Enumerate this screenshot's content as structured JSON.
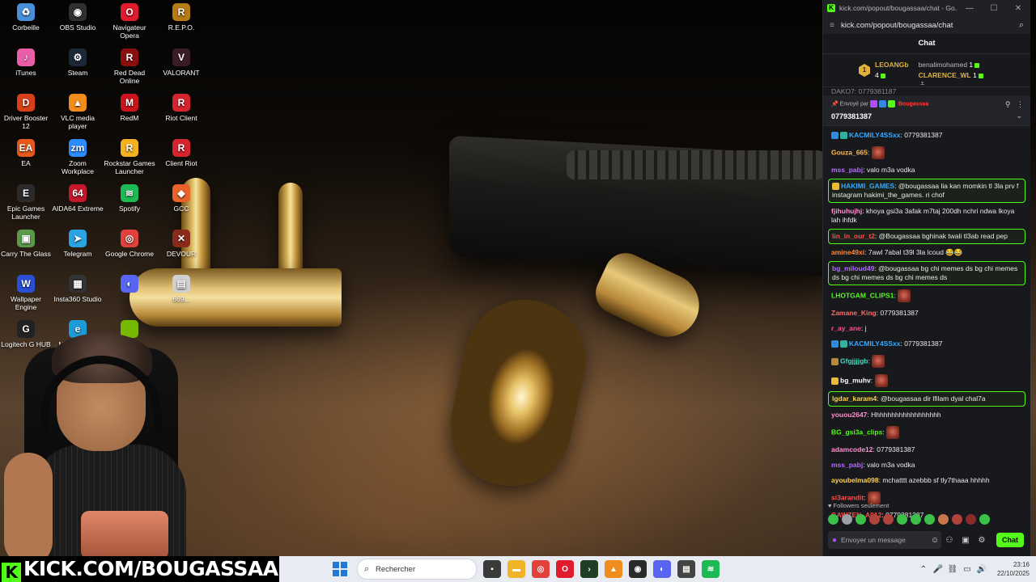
{
  "desktop_icons": [
    {
      "label": "Corbeille",
      "icon": "recycle-bin-icon",
      "color": "#4a90d9",
      "glyph": "♻"
    },
    {
      "label": "OBS Studio",
      "icon": "obs-icon",
      "color": "#302e31",
      "glyph": "◉"
    },
    {
      "label": "Navigateur Opera",
      "icon": "opera-icon",
      "color": "#e01b2e",
      "glyph": "O"
    },
    {
      "label": "R.E.P.O.",
      "icon": "repo-game-icon",
      "color": "#b47b16",
      "glyph": "R"
    },
    {
      "label": "iTunes",
      "icon": "itunes-icon",
      "color": "#e85fa8",
      "glyph": "♪"
    },
    {
      "label": "Steam",
      "icon": "steam-icon",
      "color": "#1b2838",
      "glyph": "⚙"
    },
    {
      "label": "Red Dead Online",
      "icon": "red-dead-icon",
      "color": "#8b0f0f",
      "glyph": "R"
    },
    {
      "label": "VALORANT",
      "icon": "valorant-icon",
      "color": "#3a1c26",
      "glyph": "V"
    },
    {
      "label": "Driver Booster 12",
      "icon": "driver-booster-icon",
      "color": "#d9401a",
      "glyph": "D"
    },
    {
      "label": "VLC media player",
      "icon": "vlc-icon",
      "color": "#f28c1c",
      "glyph": "▲"
    },
    {
      "label": "RedM",
      "icon": "redm-icon",
      "color": "#c9141b",
      "glyph": "M"
    },
    {
      "label": "Riot Client",
      "icon": "riot-client-icon",
      "color": "#d5242e",
      "glyph": "R"
    },
    {
      "label": "EA",
      "icon": "ea-icon",
      "color": "#e85a1c",
      "glyph": "EA"
    },
    {
      "label": "Zoom Workplace",
      "icon": "zoom-icon",
      "color": "#2d8cff",
      "glyph": "zm"
    },
    {
      "label": "Rockstar Games Launcher",
      "icon": "rockstar-icon",
      "color": "#f5b120",
      "glyph": "R"
    },
    {
      "label": "Client Riot",
      "icon": "client-riot-icon",
      "color": "#d5242e",
      "glyph": "R"
    },
    {
      "label": "Epic Games Launcher",
      "icon": "epic-games-icon",
      "color": "#2a2a2a",
      "glyph": "E"
    },
    {
      "label": "AIDA64 Extreme",
      "icon": "aida64-icon",
      "color": "#c7172b",
      "glyph": "64"
    },
    {
      "label": "Spotify",
      "icon": "spotify-icon",
      "color": "#1db954",
      "glyph": "≋"
    },
    {
      "label": "GCC",
      "icon": "gcc-icon",
      "color": "#e8622a",
      "glyph": "◆"
    },
    {
      "label": "Carry The Glass",
      "icon": "carry-the-glass-icon",
      "color": "#5a9a4a",
      "glyph": "▣"
    },
    {
      "label": "Telegram",
      "icon": "telegram-icon",
      "color": "#2aa3e0",
      "glyph": "➤"
    },
    {
      "label": "Google Chrome",
      "icon": "chrome-icon",
      "color": "#e0413a",
      "glyph": "◎"
    },
    {
      "label": "DEVOUR",
      "icon": "devour-icon",
      "color": "#8a2a1a",
      "glyph": "✕"
    },
    {
      "label": "Wallpaper Engine",
      "icon": "wallpaper-engine-icon",
      "color": "#2a4fd6",
      "glyph": "W"
    },
    {
      "label": "Insta360 Studio",
      "icon": "insta360-icon",
      "color": "#333333",
      "glyph": "▦"
    },
    {
      "label": "",
      "icon": "discord-icon",
      "color": "#5865f2",
      "glyph": "◐"
    },
    {
      "label": "669...",
      "icon": "file-icon",
      "color": "#d0d0d0",
      "glyph": "▤"
    },
    {
      "label": "Logitech G HUB",
      "icon": "logitech-ghub-icon",
      "color": "#222222",
      "glyph": "G"
    },
    {
      "label": "Microsoft Ed",
      "icon": "edge-icon",
      "color": "#1c9bd6",
      "glyph": "e"
    },
    {
      "label": "NV",
      "icon": "nvidia-icon",
      "color": "#76b900",
      "glyph": ""
    }
  ],
  "chat_window": {
    "title": "kick.com/popout/bougassaa/chat - Go...",
    "url": "kick.com/popout/bougassaa/chat",
    "heading": "Chat",
    "leaderboard": {
      "first": {
        "rank": "1",
        "name": "LEOANGb",
        "count": "4"
      },
      "second": {
        "name": "benalimohamed",
        "count": "1"
      },
      "third": {
        "name": "CLARENCE_WL",
        "count": "1"
      }
    },
    "previous_line": "DAKO7: 0779381187",
    "pinned": {
      "sent_by": "Envoyé par",
      "sender": "Bougassaa",
      "message": "0779381387"
    },
    "messages": [
      {
        "user": "KACMILY4SSxx",
        "color": "#3aa8ff",
        "text": "0779381387",
        "badges": [
          "#2f8ae0",
          "#2fb3a0"
        ],
        "emote": false,
        "hl": false
      },
      {
        "user": "Gouza_665",
        "color": "#ffb84d",
        "text": "",
        "badges": [],
        "emote": true,
        "hl": false
      },
      {
        "user": "mss_pabj",
        "color": "#b46bff",
        "text": "valo m3a vodka",
        "badges": [],
        "emote": false,
        "hl": false
      },
      {
        "user": "HAKIMI_GAMES",
        "color": "#3aa8ff",
        "text": "@bougassaa lia kan momkin tl 3la prv f instagram hakimi_the_games. ri chof",
        "badges": [
          "#e8b93a"
        ],
        "emote": false,
        "hl": true
      },
      {
        "user": "fjihuhujhj",
        "color": "#ff8fd1",
        "text": "khoya gsi3a 3afak m7taj 200dh nchri ndwa lkoya lah ihfdk",
        "badges": [],
        "emote": false,
        "hl": false
      },
      {
        "user": "lin_in_our_t2",
        "color": "#ff4d4d",
        "text": "@Bougassaa bghinak twali tl3ab read pep",
        "badges": [],
        "emote": false,
        "hl": true
      },
      {
        "user": "amine49xi",
        "color": "#ff8a3d",
        "text": "7awl 7abal t39l 3la lcoud 😂😂",
        "badges": [],
        "emote": false,
        "hl": false
      },
      {
        "user": "bg_miloud49",
        "color": "#b46bff",
        "text": "@bougassaa bg chi memes ds bg chi memes ds bg chi memes ds bg chi memes ds",
        "badges": [],
        "emote": false,
        "hl": true
      },
      {
        "user": "LHOTGAM_CLIPS1",
        "color": "#53fc18",
        "text": "",
        "badges": [],
        "emote": true,
        "hl": false
      },
      {
        "user": "Zamane_King",
        "color": "#ff6a6a",
        "text": "0779381387",
        "badges": [],
        "emote": false,
        "hl": false
      },
      {
        "user": "r_ay_ane",
        "color": "#ff4d9a",
        "text": "j",
        "badges": [],
        "emote": false,
        "hl": false
      },
      {
        "user": "KACMILY4SSxx",
        "color": "#3aa8ff",
        "text": "0779381387",
        "badges": [
          "#2f8ae0",
          "#2fb3a0"
        ],
        "emote": false,
        "hl": false
      },
      {
        "user": "Gfgjjjjgb",
        "color": "#3ee0c0",
        "text": "",
        "badges": [
          "#b48a3a"
        ],
        "emote": true,
        "hl": false
      },
      {
        "user": "bg_muhv",
        "color": "#ffffff",
        "text": "",
        "badges": [
          "#e8b93a"
        ],
        "emote": true,
        "hl": false
      },
      {
        "user": "lgdar_karam4",
        "color": "#ffd24d",
        "text": "@bougassaa dir lfilam dyal chal7a",
        "badges": [],
        "emote": false,
        "hl": true
      },
      {
        "user": "youou2647",
        "color": "#ff8fd1",
        "text": "Hhhhhhhhhhhhhhhhhh",
        "badges": [],
        "emote": false,
        "hl": false
      },
      {
        "user": "BG_gsi3a_clips",
        "color": "#53fc18",
        "text": "",
        "badges": [],
        "emote": true,
        "hl": false
      },
      {
        "user": "adamcode12",
        "color": "#ff8fd1",
        "text": "0779381387",
        "badges": [],
        "emote": false,
        "hl": false
      },
      {
        "user": "mss_pabj",
        "color": "#b46bff",
        "text": "valo m3a vodka",
        "badges": [],
        "emote": false,
        "hl": false
      },
      {
        "user": "ayoubelma098",
        "color": "#ffd24d",
        "text": "mchatttt azebbb sf tly7thaaa hhhhh",
        "badges": [],
        "emote": false,
        "hl": false
      },
      {
        "user": "si3arandit",
        "color": "#ff4d4d",
        "text": "",
        "badges": [],
        "emote": true,
        "hl": false
      },
      {
        "user": "GAWZEN_A012",
        "color": "#ff4d4d",
        "text": "0779381387",
        "badges": [],
        "emote": false,
        "hl": false
      }
    ],
    "followers_only": "Followers seulement",
    "input_placeholder": "Envoyer un message",
    "send_label": "Chat"
  },
  "watermark": {
    "k": "K",
    "text": "KICK.COM/BOUGASSAA"
  },
  "taskbar": {
    "search_placeholder": "Rechercher",
    "time": "23:16",
    "date": "22/10/2025"
  },
  "colors": {
    "kick_green": "#53fc18",
    "chat_bg": "#18191c",
    "taskbar_bg": "#e8ecf2"
  }
}
